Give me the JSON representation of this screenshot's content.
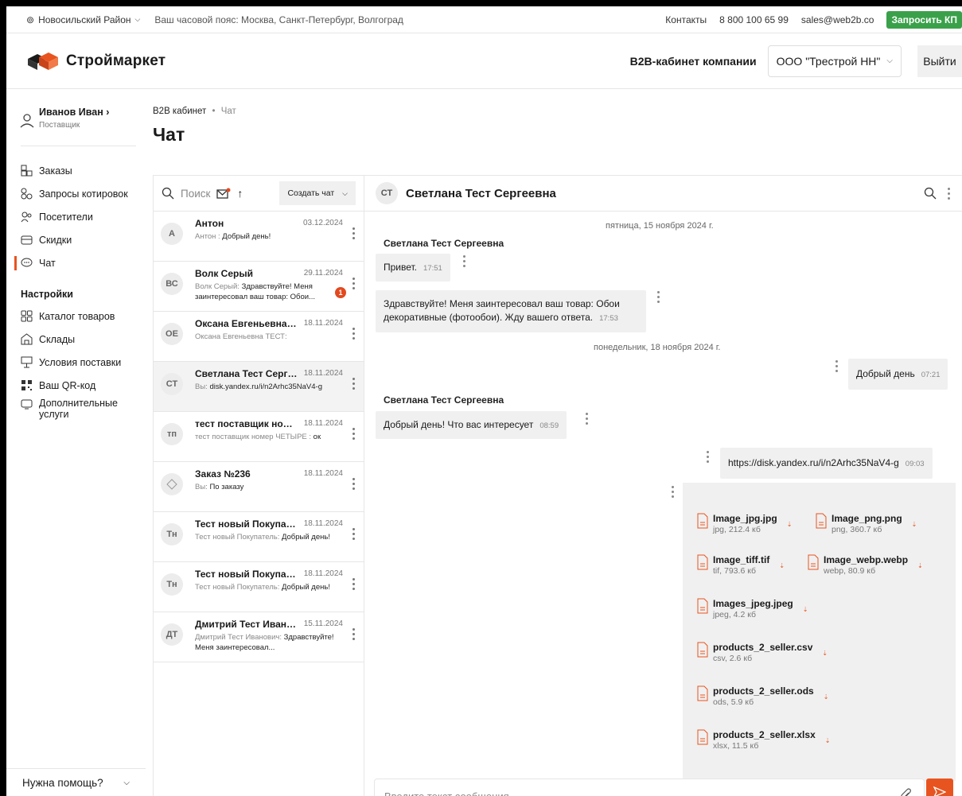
{
  "topbar": {
    "location": "Новосильский Район",
    "timezone": "Ваш часовой пояс: Москва, Санкт-Петербург, Волгоград",
    "contacts": "Контакты",
    "phone": "8 800 100 65 99",
    "email": "sales@web2b.co",
    "request_kp": "Запросить КП"
  },
  "header": {
    "brand": "Строймаркет",
    "b2b_label": "B2B-кабинет компании",
    "company": "ООО \"Трестрой НН\"",
    "logout": "Выйти"
  },
  "user": {
    "name": "Иванов Иван ›",
    "role": "Поставщик"
  },
  "nav": {
    "orders": "Заказы",
    "quotes": "Запросы котировок",
    "visitors": "Посетители",
    "discounts": "Скидки",
    "chat": "Чат",
    "settings_head": "Настройки",
    "catalog": "Каталог товаров",
    "warehouses": "Склады",
    "delivery": "Условия поставки",
    "qr": "Ваш QR-код",
    "extra": "Дополнительные услуги"
  },
  "help": "Нужна помощь?",
  "breadcrumb": {
    "root": "B2B кабинет",
    "sep": "•",
    "current": "Чат"
  },
  "page_title": "Чат",
  "chat_list": {
    "search_placeholder": "Поиск",
    "create_label": "Создать чат",
    "items": [
      {
        "initials": "А",
        "name": "Антон",
        "date": "03.12.2024",
        "sender": "Антон :",
        "preview": " Добрый день!"
      },
      {
        "initials": "ВС",
        "name": "Волк Серый",
        "date": "29.11.2024",
        "sender": "Волк Серый:",
        "preview": " Здравствуйте! Меня заинтересовал ваш товар: Обои...",
        "badge": "1"
      },
      {
        "initials": "ОЕ",
        "name": "Оксана Евгеньевна Т...",
        "date": "18.11.2024",
        "sender": "Оксана Евгеньевна ТЕСТ:",
        "preview": ""
      },
      {
        "initials": "СТ",
        "name": "Светлана Тест Серге...",
        "date": "18.11.2024",
        "sender": "Вы:",
        "preview": " disk.yandex.ru/i/n2Arhc35NaV4-g"
      },
      {
        "initials": "тп",
        "name": "тест поставщик номе...",
        "date": "18.11.2024",
        "sender": "тест поставщик номер ЧЕТЫРЕ :",
        "preview": " ок"
      },
      {
        "initials": "",
        "name": "Заказ №236",
        "date": "18.11.2024",
        "sender": "Вы:",
        "preview": " По заказу"
      },
      {
        "initials": "Тн",
        "name": "Тест новый Покупате...",
        "date": "18.11.2024",
        "sender": "Тест новый Покупатель:",
        "preview": " Добрый день!"
      },
      {
        "initials": "Тн",
        "name": "Тест новый Покупате...",
        "date": "18.11.2024",
        "sender": "Тест новый Покупатель:",
        "preview": " Добрый день!"
      },
      {
        "initials": "ДТ",
        "name": "Дмитрий Тест Иванов...",
        "date": "15.11.2024",
        "sender": "Дмитрий Тест Иванович:",
        "preview": " Здравствуйте! Меня заинтересовал..."
      }
    ]
  },
  "chat": {
    "initials": "СТ",
    "name": "Светлана Тест Сергеевна",
    "date1": "пятница, 15 ноября 2024 г.",
    "date2": "понедельник, 18 ноября 2024 г.",
    "sender": "Светлана Тест Сергеевна",
    "m1": {
      "text": "Привет.",
      "time": "17:51"
    },
    "m2": {
      "text": "Здравствуйте! Меня заинтересовал ваш товар: Обои декоративные (фотообои). Жду вашего ответа.",
      "time": "17:53"
    },
    "m3": {
      "text": "Добрый день",
      "time": "07:21"
    },
    "m4": {
      "text": "Добрый день! Что вас интересует",
      "time": "08:59"
    },
    "m5": {
      "text": "https://disk.yandex.ru/i/n2Arhc35NaV4-g",
      "time": "09:03"
    },
    "files": [
      {
        "name": "Image_jpg.jpg",
        "meta": "jpg, 212.4 кб"
      },
      {
        "name": "Image_png.png",
        "meta": "png, 360.7 кб"
      },
      {
        "name": "Image_tiff.tif",
        "meta": "tif, 793.6 кб"
      },
      {
        "name": "Image_webp.webp",
        "meta": "webp, 80.9 кб"
      },
      {
        "name": "Images_jpeg.jpeg",
        "meta": "jpeg, 4.2 кб"
      },
      {
        "name": "products_2_seller.csv",
        "meta": "csv, 2.6 кб"
      },
      {
        "name": "products_2_seller.ods",
        "meta": "ods, 5.9 кб"
      },
      {
        "name": "products_2_seller.xlsx",
        "meta": "xlsx, 11.5 кб"
      }
    ],
    "input_placeholder": "Введите текст сообщения"
  },
  "colors": {
    "accent": "#e8541f",
    "green": "#3aa14a",
    "bubble": "#f0f0f0"
  }
}
